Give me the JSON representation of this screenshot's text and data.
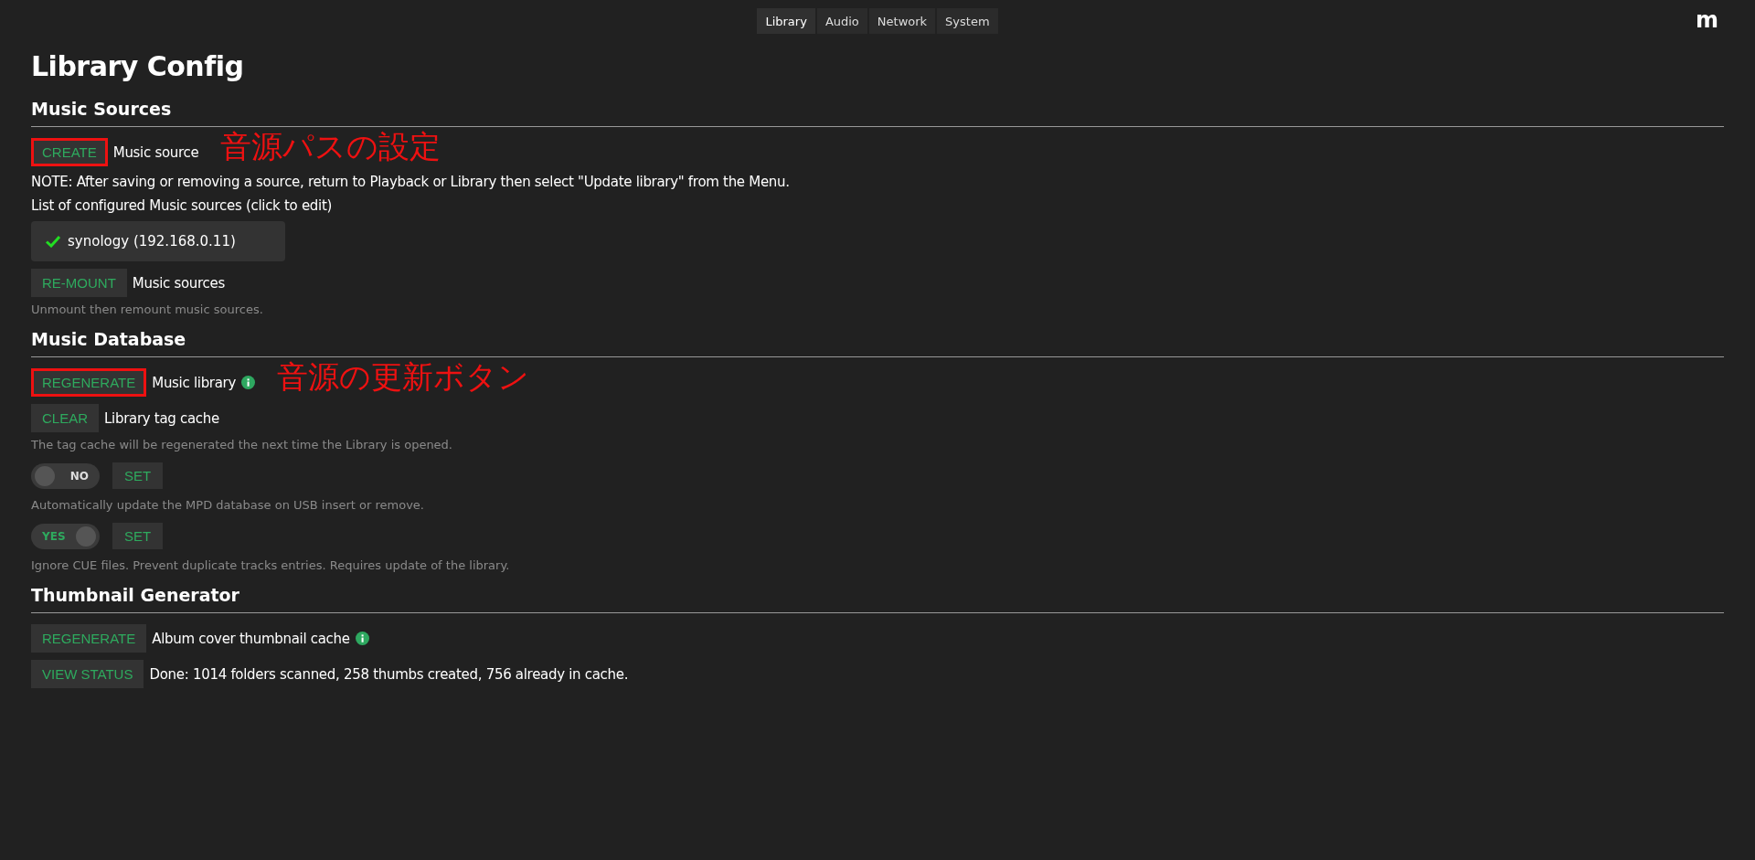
{
  "nav": {
    "tabs": [
      {
        "label": "Library",
        "selected": true
      },
      {
        "label": "Audio",
        "selected": false
      },
      {
        "label": "Network",
        "selected": false
      },
      {
        "label": "System",
        "selected": false
      }
    ],
    "logo": "m"
  },
  "title": "Library Config",
  "sections": [
    {
      "heading": "Music Sources",
      "items": [
        {
          "kind": "action",
          "button": "CREATE",
          "label": "Music source",
          "highlighted": true,
          "info": false,
          "annotation": "音源パスの設定"
        },
        {
          "kind": "text",
          "text": "NOTE: After saving or removing a source, return to Playback or Library then select \"Update library\" from the Menu."
        },
        {
          "kind": "text",
          "text": "List of configured Music sources (click to edit)"
        },
        {
          "kind": "source",
          "name": "synology (192.168.0.11)",
          "mounted": true
        },
        {
          "kind": "action",
          "button": "RE-MOUNT",
          "label": "Music sources",
          "highlighted": false,
          "info": false
        },
        {
          "kind": "hint",
          "text": "Unmount then remount music sources."
        }
      ]
    },
    {
      "heading": "Music Database",
      "items": [
        {
          "kind": "action",
          "button": "REGENERATE",
          "label": "Music library",
          "highlighted": true,
          "info": true,
          "annotation": "音源の更新ボタン"
        },
        {
          "kind": "action",
          "button": "CLEAR",
          "label": "Library tag cache",
          "highlighted": false,
          "info": false
        },
        {
          "kind": "hint",
          "text": "The tag cache will be regenerated the next time the Library is opened."
        },
        {
          "kind": "toggle",
          "on": false,
          "state_label": "NO",
          "button": "SET"
        },
        {
          "kind": "hint",
          "text": "Automatically update the MPD database on USB insert or remove."
        },
        {
          "kind": "toggle",
          "on": true,
          "state_label": "YES",
          "button": "SET"
        },
        {
          "kind": "hint",
          "text": "Ignore CUE files. Prevent duplicate tracks entries. Requires update of the library."
        }
      ]
    },
    {
      "heading": "Thumbnail Generator",
      "items": [
        {
          "kind": "action",
          "button": "REGENERATE",
          "label": "Album cover thumbnail cache",
          "highlighted": false,
          "info": true
        },
        {
          "kind": "action",
          "button": "VIEW STATUS",
          "label": "Done: 1014 folders scanned, 258 thumbs created, 756 already in cache.",
          "highlighted": false,
          "info": false
        }
      ]
    }
  ]
}
